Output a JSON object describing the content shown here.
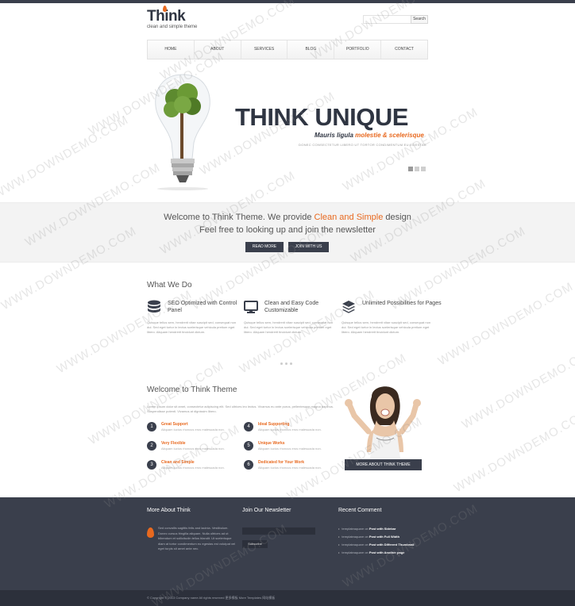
{
  "header": {
    "logo": "Think",
    "tagline": "clean and simple theme",
    "search_button": "Search"
  },
  "nav": {
    "items": [
      "HOME",
      "ABOUT",
      "SERVICES",
      "BLOG",
      "PORTFOLIO",
      "CONTACT"
    ]
  },
  "hero": {
    "title": "THINK UNIQUE",
    "subtitle_start": "Mauris ligula ",
    "subtitle_accent": "molestie & scelerisque",
    "small_text": "DONEC CONSECTETUR LIBERO UT TORTOR CONDIMENTUM EU EGESTAS"
  },
  "welcome_band": {
    "line1_start": "Welcome to Think Theme. We provide ",
    "line1_accent": "Clean and Simple",
    "line1_end": " design",
    "line2": "Feel free to looking up and join the newsletter",
    "read_more": "READ MORE",
    "join": "JOIN WITH US"
  },
  "what_we_do": {
    "title": "What We Do",
    "features": [
      {
        "title": "SEO Optimized with Control Panel",
        "icon": "database-icon",
        "text": "Quisque tellus sem, hendrerit vitae suscipit sed, consequat non dui. Sed eget tortor in lectus scelerisque vehicula pretium eget libero. Aliquam hendrerit tincidunt dictum."
      },
      {
        "title": "Clean and Easy Code Customizable",
        "icon": "monitor-icon",
        "text": "Quisque tellus sem, hendrerit vitae suscipit sed, consequat non dui. Sed eget tortor in lectus scelerisque vehicula pretium eget libero. Aliquam hendrerit tincidunt dictum."
      },
      {
        "title": "Unlimited Possibilities for Pages",
        "icon": "layers-icon",
        "text": "Quisque tellus sem, hendrerit vitae suscipit sed, consequat non dui. Sed eget tortor in lectus scelerisque vehicula pretium eget libero. Aliquam hendrerit tincidunt dictum."
      }
    ]
  },
  "welcome_section": {
    "title": "Welcome to Think Theme",
    "intro": "Lorem ipsum dolor sit amet, consectetur adipiscing elit. Sed ultrices leo lectus. Vivamus eu ante purus, pellentesque magna dapibus. Suspendisse potenti. Vivamus at dignissim libero.",
    "items": [
      {
        "num": "1",
        "title": "Great Support",
        "text": "Aliquam luctus rhoncus eros malesuada non."
      },
      {
        "num": "2",
        "title": "Very Flexible",
        "text": "Aliquam luctus rhoncus eros malesuada non."
      },
      {
        "num": "3",
        "title": "Clean and Simple",
        "text": "Aliquam luctus rhoncus eros malesuada non."
      },
      {
        "num": "4",
        "title": "Ideal Supporting",
        "text": "Aliquam luctus rhoncus eros malesuada non."
      },
      {
        "num": "5",
        "title": "Unique Works",
        "text": "Aliquam luctus rhoncus eros malesuada non."
      },
      {
        "num": "6",
        "title": "Dedicated for Your Work",
        "text": "Aliquam luctus rhoncus eros malesuada non."
      }
    ],
    "cta": "MORE ABOUT THINK THEME"
  },
  "footer": {
    "about_title": "More About Think",
    "about_text": "Sed convallis sagittis felis and lacinia. Vestibulum. Donec cursus fringilla aliquam. Nulla ultrices ad ut bibendum et sollicitudin tellus blandit. Ut scelerisque diam at tortor condimentum eu egestas est volutpat vel eget turpis sit amet ante nec.",
    "newsletter_title": "Join Our Newsletter",
    "subscribe": "Subscribe",
    "comments_title": "Recent Comment",
    "comments": [
      {
        "author": "templateaquare on ",
        "post": "Post with Sidebar"
      },
      {
        "author": "templateaquare on ",
        "post": "Post with Full Width"
      },
      {
        "author": "templateaquare on ",
        "post": "Post with Different Thumbnail"
      },
      {
        "author": "templateaquare on ",
        "post": "Post with Another page"
      }
    ],
    "copyright": "© Copyright © 2013 Company name All rights reserved 更多模板 More Templates 网站模板"
  },
  "watermark": "WWW.DOWNDEMO.COM",
  "colors": {
    "accent": "#e8691f",
    "dark": "#3a3f4c",
    "darker": "#2c303b"
  }
}
